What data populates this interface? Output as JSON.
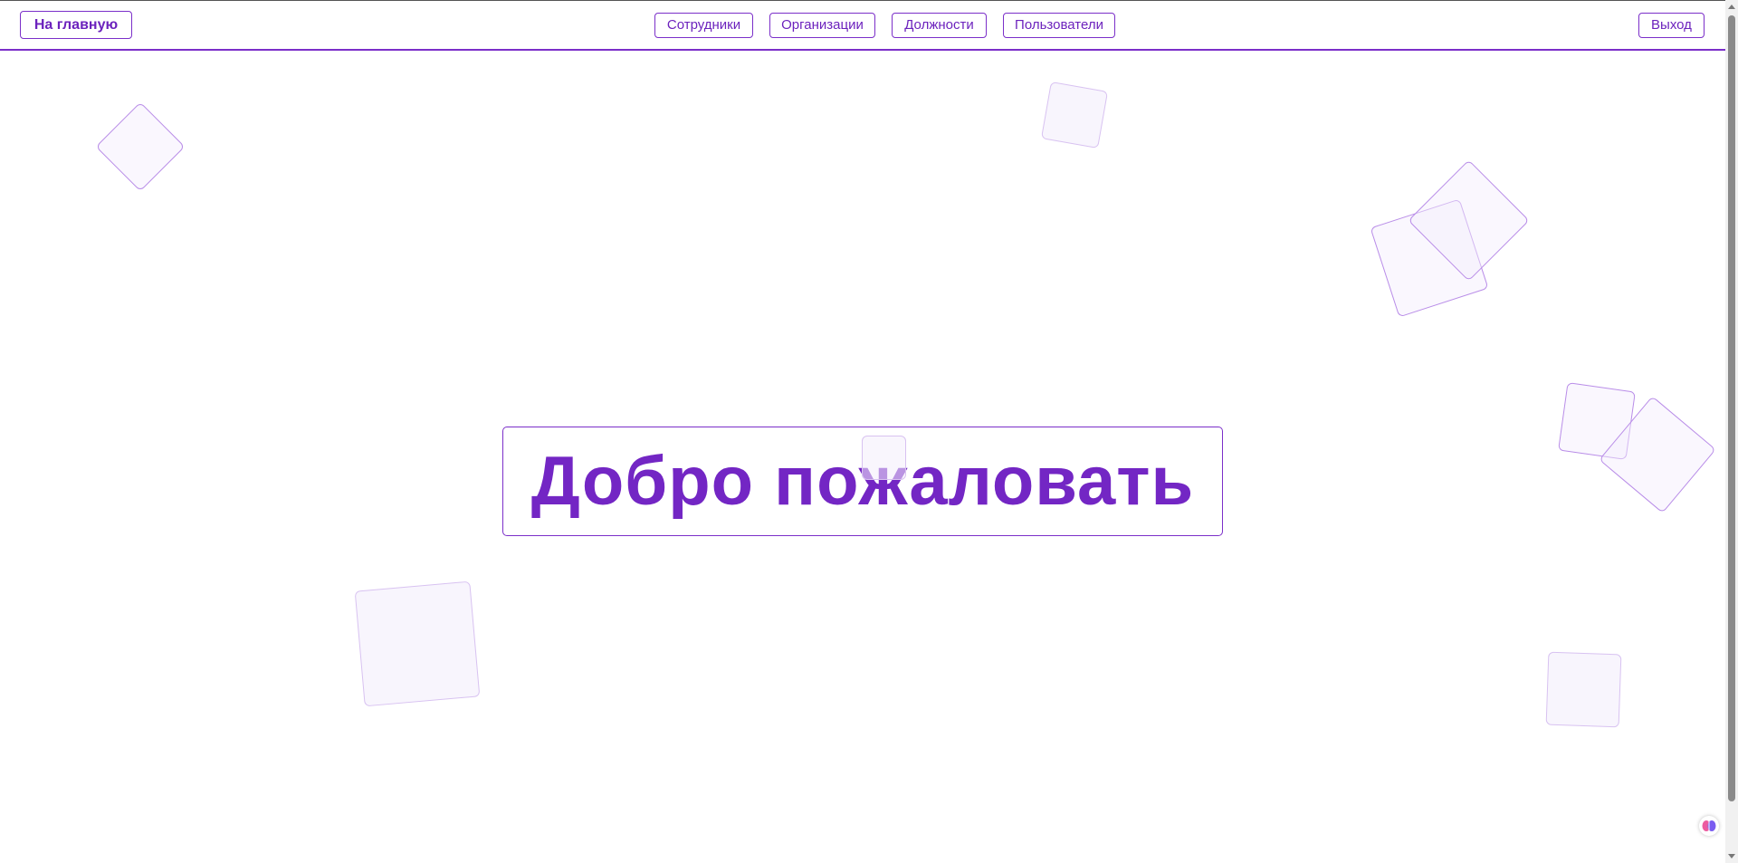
{
  "navbar": {
    "home_label": "На главную",
    "links": [
      {
        "label": "Сотрудники"
      },
      {
        "label": "Организации"
      },
      {
        "label": "Должности"
      },
      {
        "label": "Пользователи"
      }
    ],
    "logout_label": "Выход"
  },
  "main": {
    "welcome_text": "Добро пожаловать"
  },
  "colors": {
    "accent": "#7b2fc9",
    "welcome_text": "#7326c4",
    "shape_border": "#b98de8"
  },
  "icons": {
    "extension": "brain-icon"
  }
}
